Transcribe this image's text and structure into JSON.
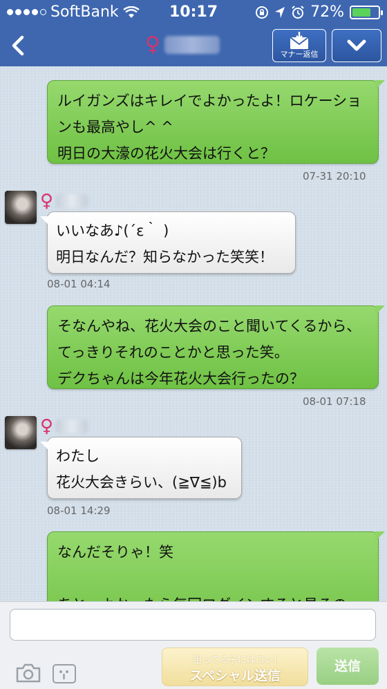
{
  "status_bar": {
    "carrier": "SoftBank",
    "time": "10:17",
    "battery": "72%",
    "battery_level": 0.72
  },
  "header": {
    "manner_reply_label": "マナー返信",
    "partner_gender_symbol": "♀"
  },
  "messages": [
    {
      "direction": "out",
      "text": "ルイガンズはキレイでよかったよ！ロケーションも最高やし^ ^\n明日の大濠の花火大会は行くと？",
      "time": "07-31 20:10"
    },
    {
      "direction": "in",
      "sender_symbol": "♀",
      "text": "いいなあ♪(´ε｀ )\n明日なんだ？知らなかった笑笑！",
      "time": "08-01 04:14"
    },
    {
      "direction": "out",
      "text": "そなんやね、花火大会のこと聞いてくるから、てっきりそれのことかと思った笑。\nデクちゃんは今年花火大会行ったの？",
      "time": "08-01 07:18"
    },
    {
      "direction": "in",
      "sender_symbol": "♀",
      "text": "わたし\n花火大会きらい、(≧∇≦)b",
      "time": "08-01 14:29"
    },
    {
      "direction": "out",
      "text": "なんだそりゃ！笑\n\nあと、よかったら毎回ログインすると見るの",
      "time": ""
    }
  ],
  "input": {
    "placeholder": "",
    "special_send_sub": "狙ってる子にはコレ!",
    "special_send_main": "スペシャル送信",
    "send_label": "送信"
  },
  "colors": {
    "header": "#3e67b0",
    "out_bubble": "#7cc94f",
    "female_symbol": "#d6336c"
  }
}
